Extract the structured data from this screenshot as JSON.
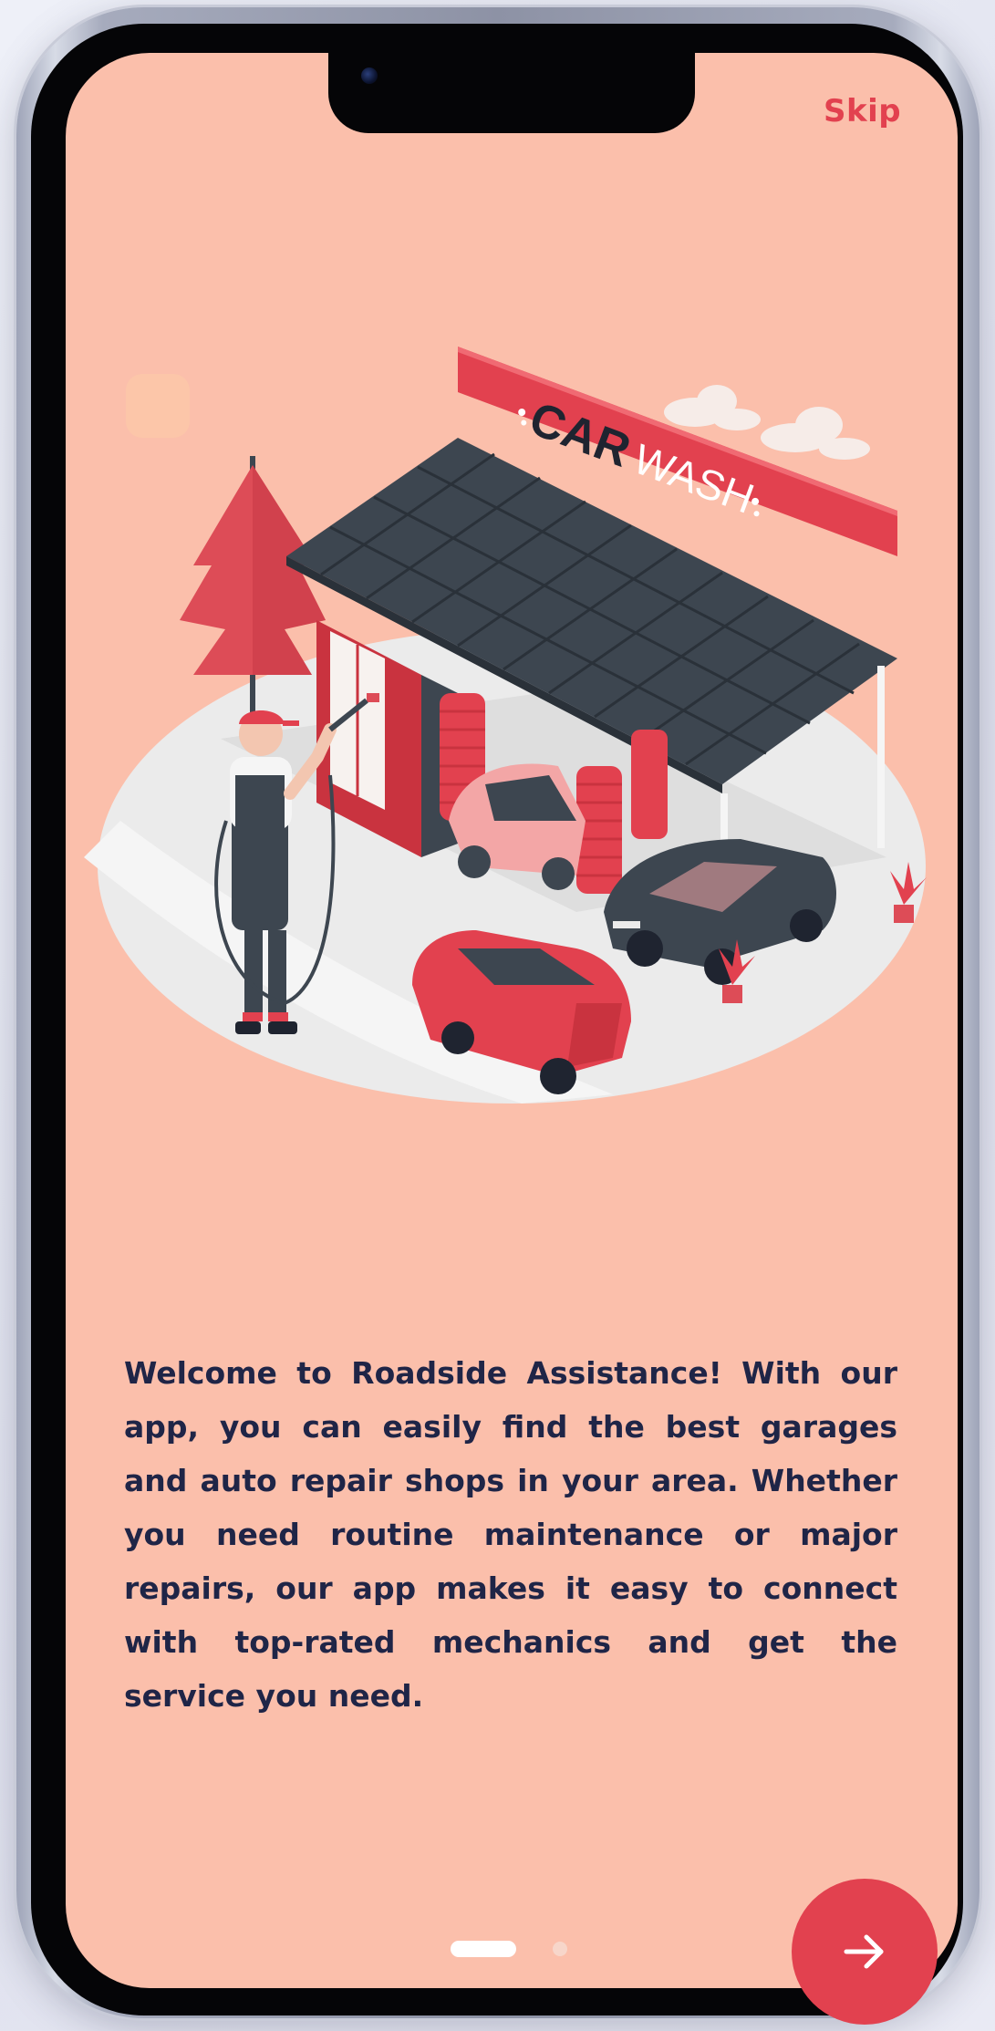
{
  "onboarding": {
    "skip_label": "Skip",
    "illustration_sign": {
      "word1": "CAR",
      "word2": "WASH"
    },
    "welcome_text": "Welcome to Roadside Assistance! With our app, you can easily find the best garages and auto repair shops in your area. Whether you need routine maintenance or major repairs, our app makes it easy to connect with top-rated mechanics and get the service you need.",
    "pager": {
      "current_page": 1,
      "total_pages": 2
    },
    "next_icon": "arrow-right-icon"
  },
  "colors": {
    "screen_background": "#fbbfab",
    "accent": "#e2414f",
    "text": "#1f2547",
    "roof": "#3d4650"
  }
}
